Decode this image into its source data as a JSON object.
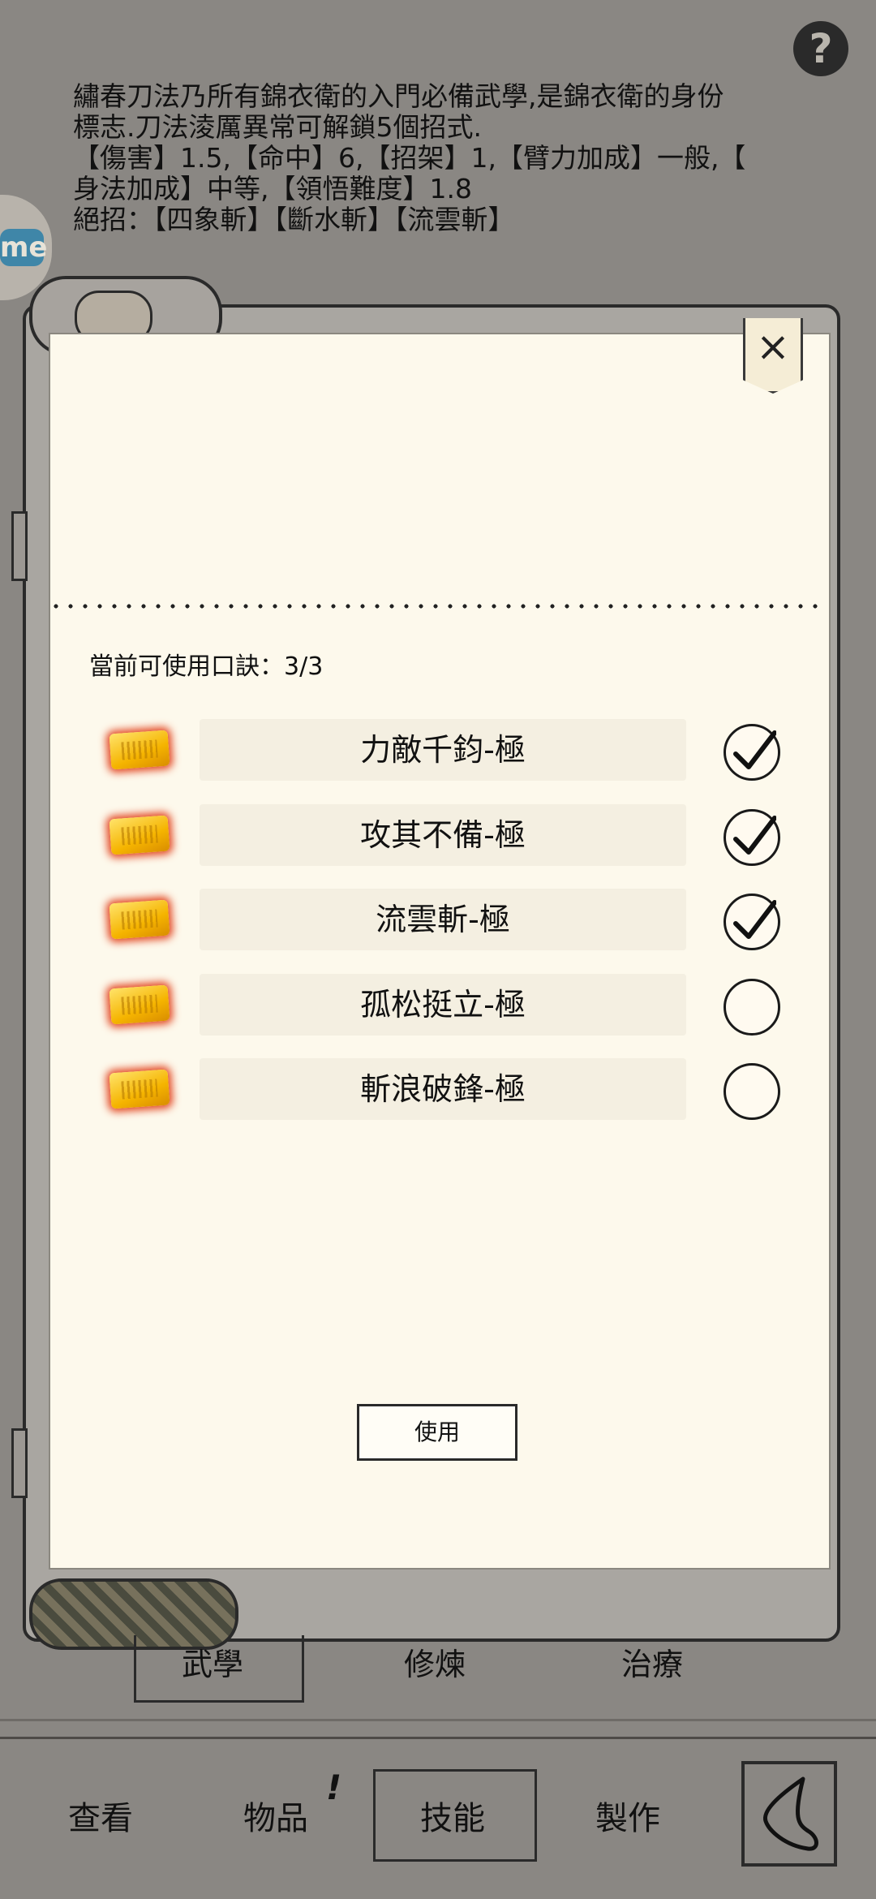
{
  "help": {
    "label": "?"
  },
  "description": {
    "lines": [
      "繡春刀法乃所有錦衣衛的入門必備武學,是錦衣衛的身份",
      "標志.刀法淩厲異常可解鎖5個招式.",
      "【傷害】1.5,【命中】6,【招架】1,【臂力加成】一般,【",
      "身法加成】中等,【領悟難度】1.8",
      "絕招：【四象斬】【斷水斬】【流雲斬】"
    ]
  },
  "side_tag": {
    "label": "me"
  },
  "modal": {
    "close_label": "×",
    "quota_text": "當前可使用口訣：3/3",
    "items": [
      {
        "name": "力敵千鈞-極",
        "checked": true
      },
      {
        "name": "攻其不備-極",
        "checked": true
      },
      {
        "name": "流雲斬-極",
        "checked": true
      },
      {
        "name": "孤松挺立-極",
        "checked": false
      },
      {
        "name": "斬浪破鋒-極",
        "checked": false
      }
    ],
    "use_label": "使用"
  },
  "sub_tabs": [
    "武學",
    "修煉",
    "治療"
  ],
  "bottom_nav": {
    "items": [
      "查看",
      "物品",
      "技能",
      "製作"
    ],
    "selected": "技能",
    "item_badge": "!"
  },
  "colors": {
    "background": "#8a8783",
    "paper": "#fdf9ec",
    "token_glow": "#e2451f",
    "token_gold": "#f5b400"
  }
}
